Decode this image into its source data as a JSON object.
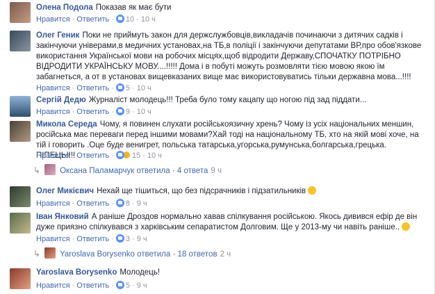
{
  "comments": [
    {
      "author": "Олена Подола",
      "text": "Показав як має бути",
      "like": "Нравится",
      "reply": "Ответить",
      "reactions": "10",
      "time": "10 ч"
    },
    {
      "author": "Олег Геник",
      "text": "Поки не приймуть закон для держслужбовців,викладачів починаючи з дитячих садків і закінчуючи універами,в медичних установах,на ТБ,в поліції і закінчуючи депутатами ВР,про обов'язкове використання Української мови на робочих місцях,щоб відродити Державу,СПОЧАТКУ ПОТРІБНО ВІДРОДИТИ УКРАЇНСЬКУ МОВУ....!!!!! Дома і в побуті можуть розмовляти тією мовою якою їм забагнеться, а от в установах вищевказаних вище має використовуватись тільки державна мова...!!!!",
      "like": "Нравится",
      "reply": "Ответить",
      "reactions": "5",
      "time": "10 ч"
    },
    {
      "author": "Сергій Дедю",
      "text": "Журналіст молодець!!! Треба було тому кацапу що ногою під зад піддати...",
      "like": "Нравится",
      "reply": "Ответить",
      "reactions": "9",
      "time": "10 ч"
    },
    {
      "author": "Микола Середа",
      "text": "Чому, я повинен слухати російськоязичну хрень? Чому із усіх національних меншин, російська має переваги перед іншими мовами?Хай тоді на національному ТБ, хто на якій мові хоче, на тій і говорить .Оце буде венигрет, польська татарська,угорська,румунська,болгарська,грецька. ПІПЕЦЬ!!!!",
      "like": "Нравится",
      "reply": "Ответить",
      "reactions": "15",
      "time": "10 ч",
      "replies": {
        "author": "Оксана Паламарчук",
        "replied": "ответила",
        "count": "4 ответа",
        "time": "9 ч"
      }
    },
    {
      "author": "Олег Микієвич",
      "text": "Нехай ще тішиться, що без підсрачників і підзатильників",
      "like": "Нравится",
      "reply": "Ответить",
      "reactions": "8",
      "time": "9 ч"
    },
    {
      "author": "Іван Янковий",
      "text": "А раніше Дроздов нормально хавав спілкування російською. Якось дивився ефір де він дуже приязно спілкувався з харківським сепаратистом Долговим. Ще у 2013-му чи навіть раніше..",
      "like": "Нравится",
      "reply": "Ответить",
      "reactions": "3",
      "time": "9 ч",
      "replies": {
        "author": "Yaroslava Borysenko",
        "replied": "ответила",
        "count": "18 ответов",
        "time": "2 ч"
      }
    },
    {
      "author": "Yaroslava Borysenko",
      "text": "Молодець!",
      "like": "Нравится",
      "reply": "Ответить",
      "reactions": "5",
      "time": "9 ч"
    }
  ],
  "colors": {
    "link": "#365899",
    "action": "#4267b2",
    "meta": "#90949c",
    "like_badge": "#5890ff"
  }
}
